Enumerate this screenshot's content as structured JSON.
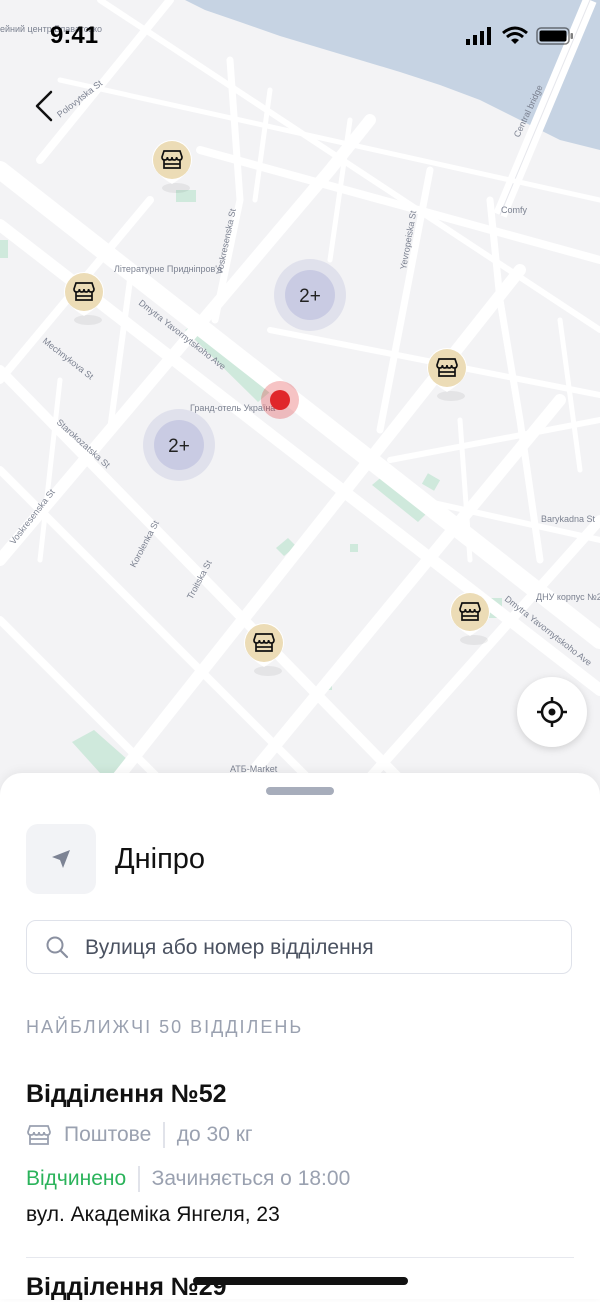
{
  "status_bar": {
    "time": "9:41"
  },
  "map": {
    "streets": [
      "Polovytska St",
      "Voskresenska St",
      "Yevropeiska St",
      "Mechnykova St",
      "Dmytra Yavornytskoho Ave",
      "Starokozatska St",
      "Korolenka St",
      "Troitska St",
      "Barykadna St",
      "Central bridge",
      "Voskresenska St",
      "Dmytra Yavornytskoho Ave"
    ],
    "pois": [
      "Comfy",
      "Літературне Придніпров'я",
      "Гранд-отель Україна",
      "ДНУ корпус №2",
      "АТБ-Market",
      "ейний центр Блаватсько"
    ],
    "clusters": [
      "2+",
      "2+"
    ],
    "colors": {
      "land": "#f3f3f5",
      "water": "#c6d3e3",
      "park": "#cfe9dc",
      "road": "#ffffff",
      "marker": "#ecdcb6",
      "cluster": "#c9cbe3",
      "current": "#e0262a"
    }
  },
  "sheet": {
    "city": "Дніпро",
    "search_placeholder": "Вулиця або номер відділення",
    "section_title": "НАЙБЛИЖЧІ 50 ВІДДІЛЕНЬ",
    "branches": [
      {
        "title": "Відділення №52",
        "type": "Поштове",
        "weight": "до 30 кг",
        "status": "Відчинено",
        "hours": "Зачиняється о 18:00",
        "address": "вул. Академіка Янгеля, 23"
      },
      {
        "title": "Відділення №29"
      }
    ]
  }
}
